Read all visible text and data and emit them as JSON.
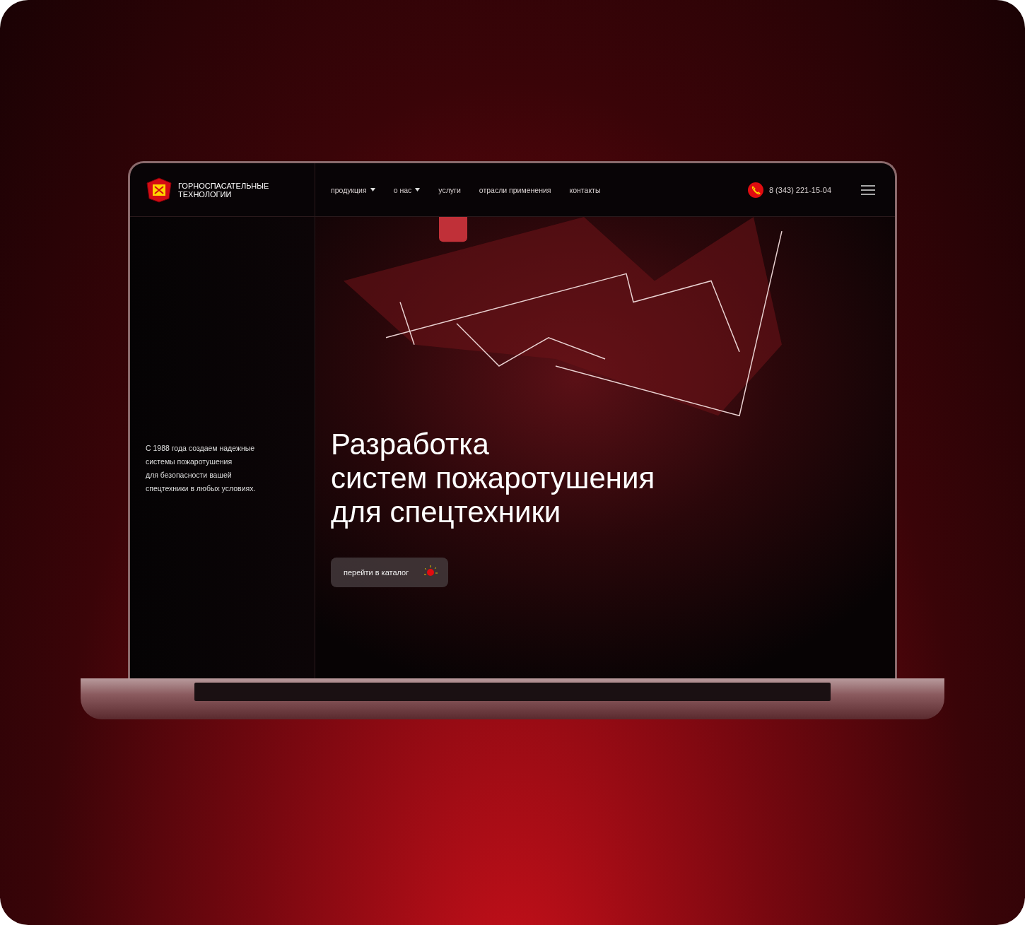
{
  "header": {
    "logo_text": [
      "ГОРНОСПАСАТЕЛЬНЫЕ",
      "ТЕХНОЛОГИИ"
    ],
    "nav": [
      {
        "label": "продукция",
        "has_dropdown": true
      },
      {
        "label": "о нас",
        "has_dropdown": true
      },
      {
        "label": "услуги",
        "has_dropdown": false
      },
      {
        "label": "отрасли применения",
        "has_dropdown": false
      },
      {
        "label": "контакты",
        "has_dropdown": false
      }
    ],
    "phone": "8 (343) 221-15-04"
  },
  "intro": [
    "С 1988 года создаем надежные",
    "системы пожаротушения",
    "для безопасности вашей",
    "спецтехники в любых условиях."
  ],
  "hero": {
    "headline": [
      "Разработка",
      "систем пожаротушения",
      "для спецтехники"
    ],
    "button": "перейти в каталог"
  }
}
